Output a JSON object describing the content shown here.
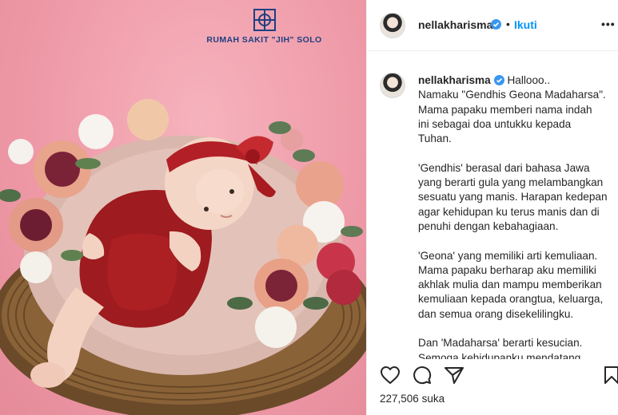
{
  "watermark": {
    "text": "RUMAH SAKIT \"JIH\" SOLO"
  },
  "post": {
    "username": "nellakharisma",
    "follow_label": "Ikuti",
    "dot": "•",
    "more": "•••",
    "caption_lines": [
      "Hallooo..",
      "Namaku \"Gendhis Geona Madaharsa\".",
      "Mama papaku memberi nama indah",
      "ini sebagai doa untukku kepada",
      "Tuhan.",
      "",
      "'Gendhis' berasal dari bahasa Jawa",
      "yang berarti gula yang melambangkan",
      "sesuatu yang manis. Harapan kedepan",
      "agar kehidupan ku terus manis dan di",
      "penuhi dengan kebahagiaan.",
      "",
      "'Geona' yang memiliki arti kemuliaan.",
      "Mama papaku berharap aku memiliki",
      "akhlak mulia dan mampu memberikan",
      "kemuliaan kepada orangtua, keluarga,",
      "dan semua orang disekelilingku.",
      "",
      "Dan 'Madaharsa' berarti kesucian.",
      "Semoga kehidupanku mendatang"
    ],
    "likes": "227,506",
    "likes_suffix": "suka",
    "icons": [
      "heart-icon",
      "comment-icon",
      "share-icon",
      "bookmark-icon"
    ]
  },
  "colors": {
    "brand_blue": "#0095f6",
    "verified_blue": "#3897f0",
    "watermark_navy": "#1f3f82",
    "backdrop_pink": "#ef9aa8"
  }
}
